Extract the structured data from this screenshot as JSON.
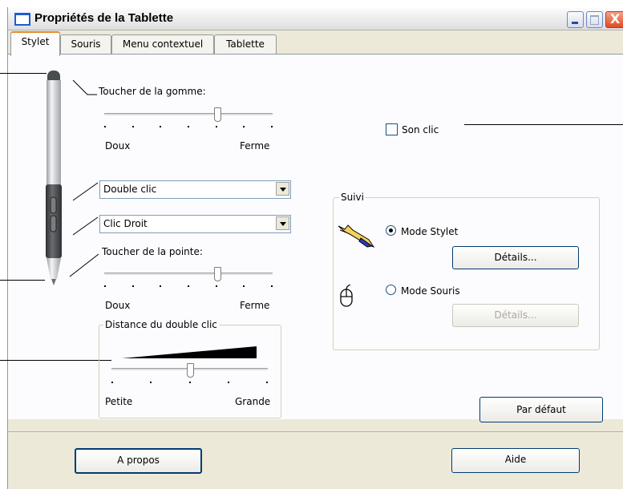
{
  "window": {
    "title": "Propriétés de la Tablette",
    "controls": {
      "minimize": "minimize-icon",
      "maximize": "maximize-icon",
      "close": "close-icon",
      "close_glyph": "X"
    }
  },
  "tabs": [
    {
      "label": "Stylet",
      "active": true
    },
    {
      "label": "Souris",
      "active": false
    },
    {
      "label": "Menu contextuel",
      "active": false
    },
    {
      "label": "Tablette",
      "active": false
    }
  ],
  "stylet": {
    "eraser_feel": {
      "label": "Toucher de la gomme:",
      "min_label": "Doux",
      "max_label": "Ferme",
      "level_fraction": 0.67,
      "ticks": 7
    },
    "upper_button": {
      "value": "Double clic"
    },
    "lower_button": {
      "value": "Clic Droit"
    },
    "tip_feel": {
      "label": "Toucher de la pointe:",
      "min_label": "Doux",
      "max_label": "Ferme",
      "level_fraction": 0.67,
      "ticks": 7
    },
    "double_click_distance": {
      "legend": "Distance du double clic",
      "min_label": "Petite",
      "max_label": "Grande",
      "level_fraction": 0.5,
      "ticks": 5
    },
    "click_sound": {
      "label": "Son clic",
      "checked": false
    },
    "tracking": {
      "legend": "Suivi",
      "pen_mode": {
        "label": "Mode Stylet",
        "selected": true,
        "icon": "pen-icon",
        "details_label": "Détails..."
      },
      "mouse_mode": {
        "label": "Mode Souris",
        "selected": false,
        "icon": "mouse-icon",
        "details_label": "Détails..."
      }
    },
    "default_button": "Par défaut"
  },
  "footer": {
    "about_button": "A propos",
    "help_button": "Aide"
  },
  "colors": {
    "tab_highlight": "#e68b2c",
    "window_face": "#ece9d8",
    "panel": "#fcfcfe",
    "pen_body": "#cfd1d3",
    "pen_grip": "#4a4d50"
  }
}
